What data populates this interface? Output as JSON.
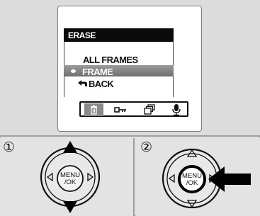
{
  "screen": {
    "title": "ERASE",
    "menu_items": [
      {
        "label": "ALL FRAMES",
        "selected": false
      },
      {
        "label": "FRAME",
        "selected": true
      },
      {
        "label": "BACK",
        "selected": false
      }
    ],
    "tab_icons": [
      "trash-icon",
      "key-icon",
      "frames-icon",
      "microphone-icon"
    ],
    "selected_tab": "trash-icon"
  },
  "steps": [
    {
      "number": "①",
      "button_label_line1": "MENU",
      "button_label_line2": "/OK",
      "highlight": "up-down-arrows"
    },
    {
      "number": "②",
      "button_label_line1": "MENU",
      "button_label_line2": "/OK",
      "highlight": "press-center"
    }
  ],
  "colors": {
    "background": "#e3e3e3",
    "title_bar": "#0a0a0a",
    "selection": "#7f7f7f"
  }
}
